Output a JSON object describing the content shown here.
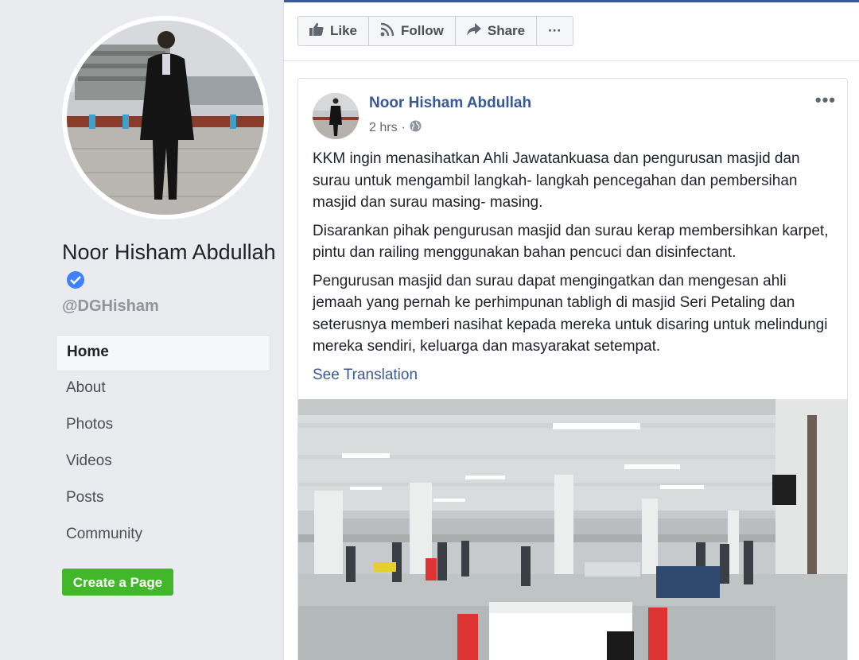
{
  "page": {
    "name": "Noor Hisham Abdullah",
    "handle": "@DGHisham",
    "verified": true,
    "accent_color": "#3b5998",
    "link_color": "#385898"
  },
  "nav": {
    "items": [
      {
        "label": "Home",
        "active": true
      },
      {
        "label": "About"
      },
      {
        "label": "Photos"
      },
      {
        "label": "Videos"
      },
      {
        "label": "Posts"
      },
      {
        "label": "Community"
      }
    ],
    "create_page_label": "Create a Page",
    "create_page_color": "#42b72a"
  },
  "actions": {
    "like_label": "Like",
    "follow_label": "Follow",
    "share_label": "Share",
    "more_label": "···"
  },
  "post": {
    "author": "Noor Hisham Abdullah",
    "time": "2 hrs",
    "audience_icon": "globe-icon",
    "more_label": "•••",
    "paragraphs": [
      "KKM ingin menasihatkan Ahli Jawatankuasa dan pengurusan masjid dan surau untuk mengambil langkah- langkah pencegahan dan pembersihan masjid dan surau masing- masing.",
      "Disarankan pihak pengurusan masjid dan surau kerap membersihkan karpet, pintu dan railing menggunakan bahan pencuci dan disinfectant.",
      "Pengurusan masjid dan surau dapat mengingatkan dan mengesan ahli jemaah yang pernah ke perhimpunan tabligh di masjid Seri Petaling dan seterusnya memberi nasihat kepada mereka untuk disaring untuk melindungi mereka sendiri, keluarga dan masyarakat setempat."
    ],
    "see_translation": "See Translation"
  }
}
